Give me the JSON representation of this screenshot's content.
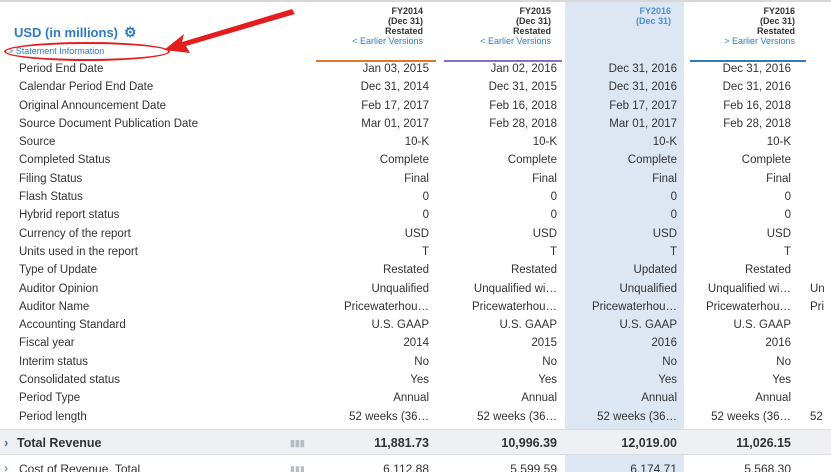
{
  "header": {
    "currency_label": "USD (in millions)",
    "statement_info": "> Statement Information",
    "columns": [
      {
        "year": "FY2014",
        "date": "(Dec 31)",
        "status": "Restated",
        "earlier": "< Earlier Versions",
        "underline": "#e0762b"
      },
      {
        "year": "FY2015",
        "date": "(Dec 31)",
        "status": "Restated",
        "earlier": "< Earlier Versions",
        "underline": "#8e6bc4"
      },
      {
        "year": "FY2016",
        "date": "(Dec 31)",
        "status": "",
        "earlier": "",
        "underline": "#dde6f3"
      },
      {
        "year": "FY2016",
        "date": "(Dec 31)",
        "status": "Restated",
        "earlier": "> Earlier Versions",
        "underline": "#2f7bbf"
      }
    ]
  },
  "rows": [
    {
      "label": "Period End Date",
      "v": [
        "Jan 03, 2015",
        "Jan 02, 2016",
        "Dec 31, 2016",
        "Dec 31, 2016",
        ""
      ]
    },
    {
      "label": "Calendar Period End Date",
      "v": [
        "Dec 31, 2014",
        "Dec 31, 2015",
        "Dec 31, 2016",
        "Dec 31, 2016",
        ""
      ]
    },
    {
      "label": "Original Announcement Date",
      "v": [
        "Feb 17, 2017",
        "Feb 16, 2018",
        "Feb 17, 2017",
        "Feb 16, 2018",
        ""
      ]
    },
    {
      "label": "Source Document Publication Date",
      "v": [
        "Mar 01, 2017",
        "Feb 28, 2018",
        "Mar 01, 2017",
        "Feb 28, 2018",
        ""
      ]
    },
    {
      "label": "Source",
      "v": [
        "10-K",
        "10-K",
        "10-K",
        "10-K",
        ""
      ]
    },
    {
      "label": "Completed Status",
      "v": [
        "Complete",
        "Complete",
        "Complete",
        "Complete",
        ""
      ]
    },
    {
      "label": "Filing Status",
      "v": [
        "Final",
        "Final",
        "Final",
        "Final",
        ""
      ]
    },
    {
      "label": "Flash Status",
      "v": [
        "0",
        "0",
        "0",
        "0",
        ""
      ]
    },
    {
      "label": "Hybrid report status",
      "v": [
        "0",
        "0",
        "0",
        "0",
        ""
      ]
    },
    {
      "label": "Currency of the report",
      "v": [
        "USD",
        "USD",
        "USD",
        "USD",
        ""
      ]
    },
    {
      "label": "Units used in the report",
      "v": [
        "T",
        "T",
        "T",
        "T",
        ""
      ]
    },
    {
      "label": "Type of Update",
      "v": [
        "Restated",
        "Restated",
        "Updated",
        "Restated",
        ""
      ]
    },
    {
      "label": "Auditor Opinion",
      "v": [
        "Unqualified",
        "Unqualified wi…",
        "Unqualified",
        "Unqualified wi…",
        "Un"
      ]
    },
    {
      "label": "Auditor Name",
      "v": [
        "Pricewaterhou…",
        "Pricewaterhou…",
        "Pricewaterhou…",
        "Pricewaterhou…",
        "Pri"
      ]
    },
    {
      "label": "Accounting Standard",
      "v": [
        "U.S. GAAP",
        "U.S. GAAP",
        "U.S. GAAP",
        "U.S. GAAP",
        ""
      ]
    },
    {
      "label": "Fiscal year",
      "v": [
        "2014",
        "2015",
        "2016",
        "2016",
        ""
      ]
    },
    {
      "label": "Interim status",
      "v": [
        "No",
        "No",
        "No",
        "No",
        ""
      ]
    },
    {
      "label": "Consolidated status",
      "v": [
        "Yes",
        "Yes",
        "Yes",
        "Yes",
        ""
      ]
    },
    {
      "label": "Period Type",
      "v": [
        "Annual",
        "Annual",
        "Annual",
        "Annual",
        ""
      ]
    },
    {
      "label": "Period length",
      "v": [
        "52 weeks (36…",
        "52 weeks (36…",
        "52 weeks (36…",
        "52 weeks (36…",
        "52"
      ]
    }
  ],
  "total_revenue": {
    "label": "Total Revenue",
    "v": [
      "11,881.73",
      "10,996.39",
      "12,019.00",
      "11,026.15"
    ]
  },
  "cost_of_revenue": {
    "label": "Cost of Revenue, Total",
    "v": [
      "6,112.88",
      "5,599.59",
      "6,174.71",
      "5,568.30"
    ]
  },
  "icons": {
    "gear": "gear-icon",
    "chevron": "chevron-right-icon",
    "bar": "bar-chart-icon"
  }
}
